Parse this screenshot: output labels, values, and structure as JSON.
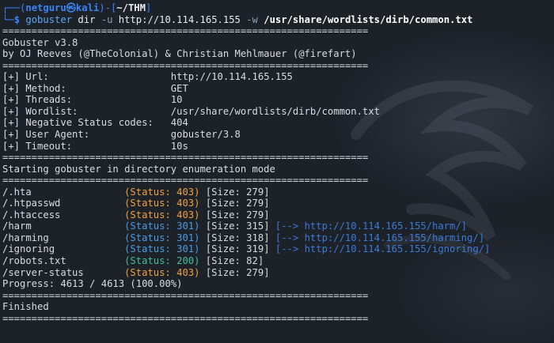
{
  "prompt": {
    "frame_top": "┌──(",
    "user_host": "netguru㉿kali",
    "mid": ")-[",
    "dir": "~/THM",
    "end": "]",
    "frame_bottom": "└─",
    "dollar": "$",
    "command": "gobuster",
    "args": " dir ",
    "flag_u": "-u",
    "url": " http://10.114.165.155 ",
    "flag_w": "-w",
    "wordlist": " /usr/share/wordlists/dirb/common.txt"
  },
  "separator": "===============================================================",
  "banner": {
    "version": "Gobuster v3.8",
    "authors": "by OJ Reeves (@TheColonial) & Christian Mehlmauer (@firefart)"
  },
  "config": [
    {
      "key": "[+] Url:                     ",
      "value": "http://10.114.165.155"
    },
    {
      "key": "[+] Method:                  ",
      "value": "GET"
    },
    {
      "key": "[+] Threads:                 ",
      "value": "10"
    },
    {
      "key": "[+] Wordlist:                ",
      "value": "/usr/share/wordlists/dirb/common.txt"
    },
    {
      "key": "[+] Negative Status codes:   ",
      "value": "404"
    },
    {
      "key": "[+] User Agent:              ",
      "value": "gobuster/3.8"
    },
    {
      "key": "[+] Timeout:                 ",
      "value": "10s"
    }
  ],
  "starting_msg": "Starting gobuster in directory enumeration mode",
  "results": [
    {
      "path": "/.hta                ",
      "status": "(Status: 403)",
      "code": "403",
      "size": " [Size: 279]",
      "redirect": ""
    },
    {
      "path": "/.htpasswd           ",
      "status": "(Status: 403)",
      "code": "403",
      "size": " [Size: 279]",
      "redirect": ""
    },
    {
      "path": "/.htaccess           ",
      "status": "(Status: 403)",
      "code": "403",
      "size": " [Size: 279]",
      "redirect": ""
    },
    {
      "path": "/harm                ",
      "status": "(Status: 301)",
      "code": "301",
      "size": " [Size: 315]",
      "redirect": " [--> http://10.114.165.155/harm/]"
    },
    {
      "path": "/harming             ",
      "status": "(Status: 301)",
      "code": "301",
      "size": " [Size: 318]",
      "redirect": " [--> http://10.114.165.155/harming/]"
    },
    {
      "path": "/ignoring            ",
      "status": "(Status: 301)",
      "code": "301",
      "size": " [Size: 319]",
      "redirect": " [--> http://10.114.165.155/ignoring/]"
    },
    {
      "path": "/robots.txt          ",
      "status": "(Status: 200)",
      "code": "200",
      "size": " [Size: 82]",
      "redirect": ""
    },
    {
      "path": "/server-status       ",
      "status": "(Status: 403)",
      "code": "403",
      "size": " [Size: 279]",
      "redirect": ""
    }
  ],
  "progress": "Progress: 4613 / 4613 (100.00%)",
  "finished": "Finished"
}
